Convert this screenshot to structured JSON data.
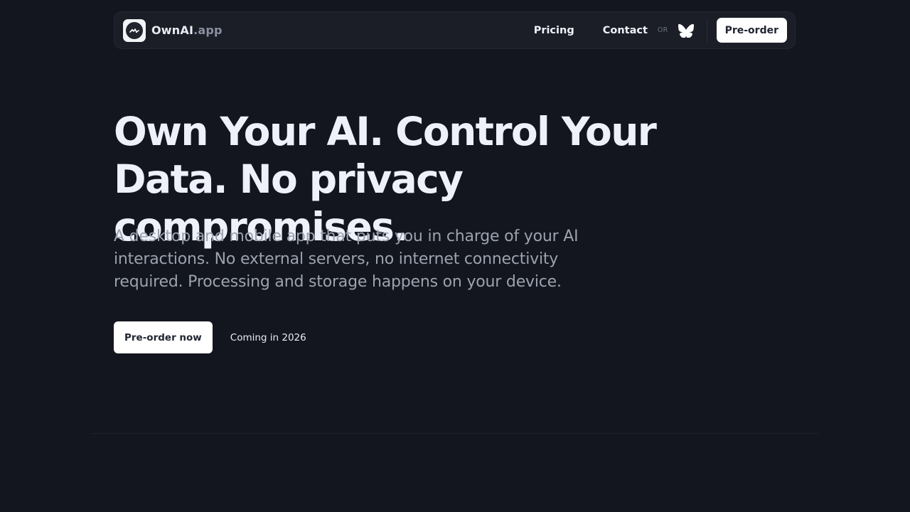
{
  "brand": {
    "name": "OwnAI",
    "tld": ".app",
    "logo_icon": "ai-logo-icon"
  },
  "nav": {
    "links": [
      {
        "label": "Pricing"
      },
      {
        "label": "Contact"
      }
    ],
    "or_label": "OR",
    "social_icon": "bluesky-butterfly-icon",
    "cta_label": "Pre-order"
  },
  "hero": {
    "title_line1": "Own Your AI. Control Your",
    "title_line2": "Data. No privacy compromises.",
    "subtitle": "A desktop and mobile app that puts you in charge of your AI interactions. No external servers, no internet connectivity required. Processing and storage happens on your device.",
    "cta_label": "Pre-order now",
    "note": "Coming in 2026"
  },
  "colors": {
    "background": "#13161f",
    "navbar": "#1b1d27",
    "button": "#ffffff",
    "heading": "#eef1fb",
    "muted": "#9da2ae"
  }
}
